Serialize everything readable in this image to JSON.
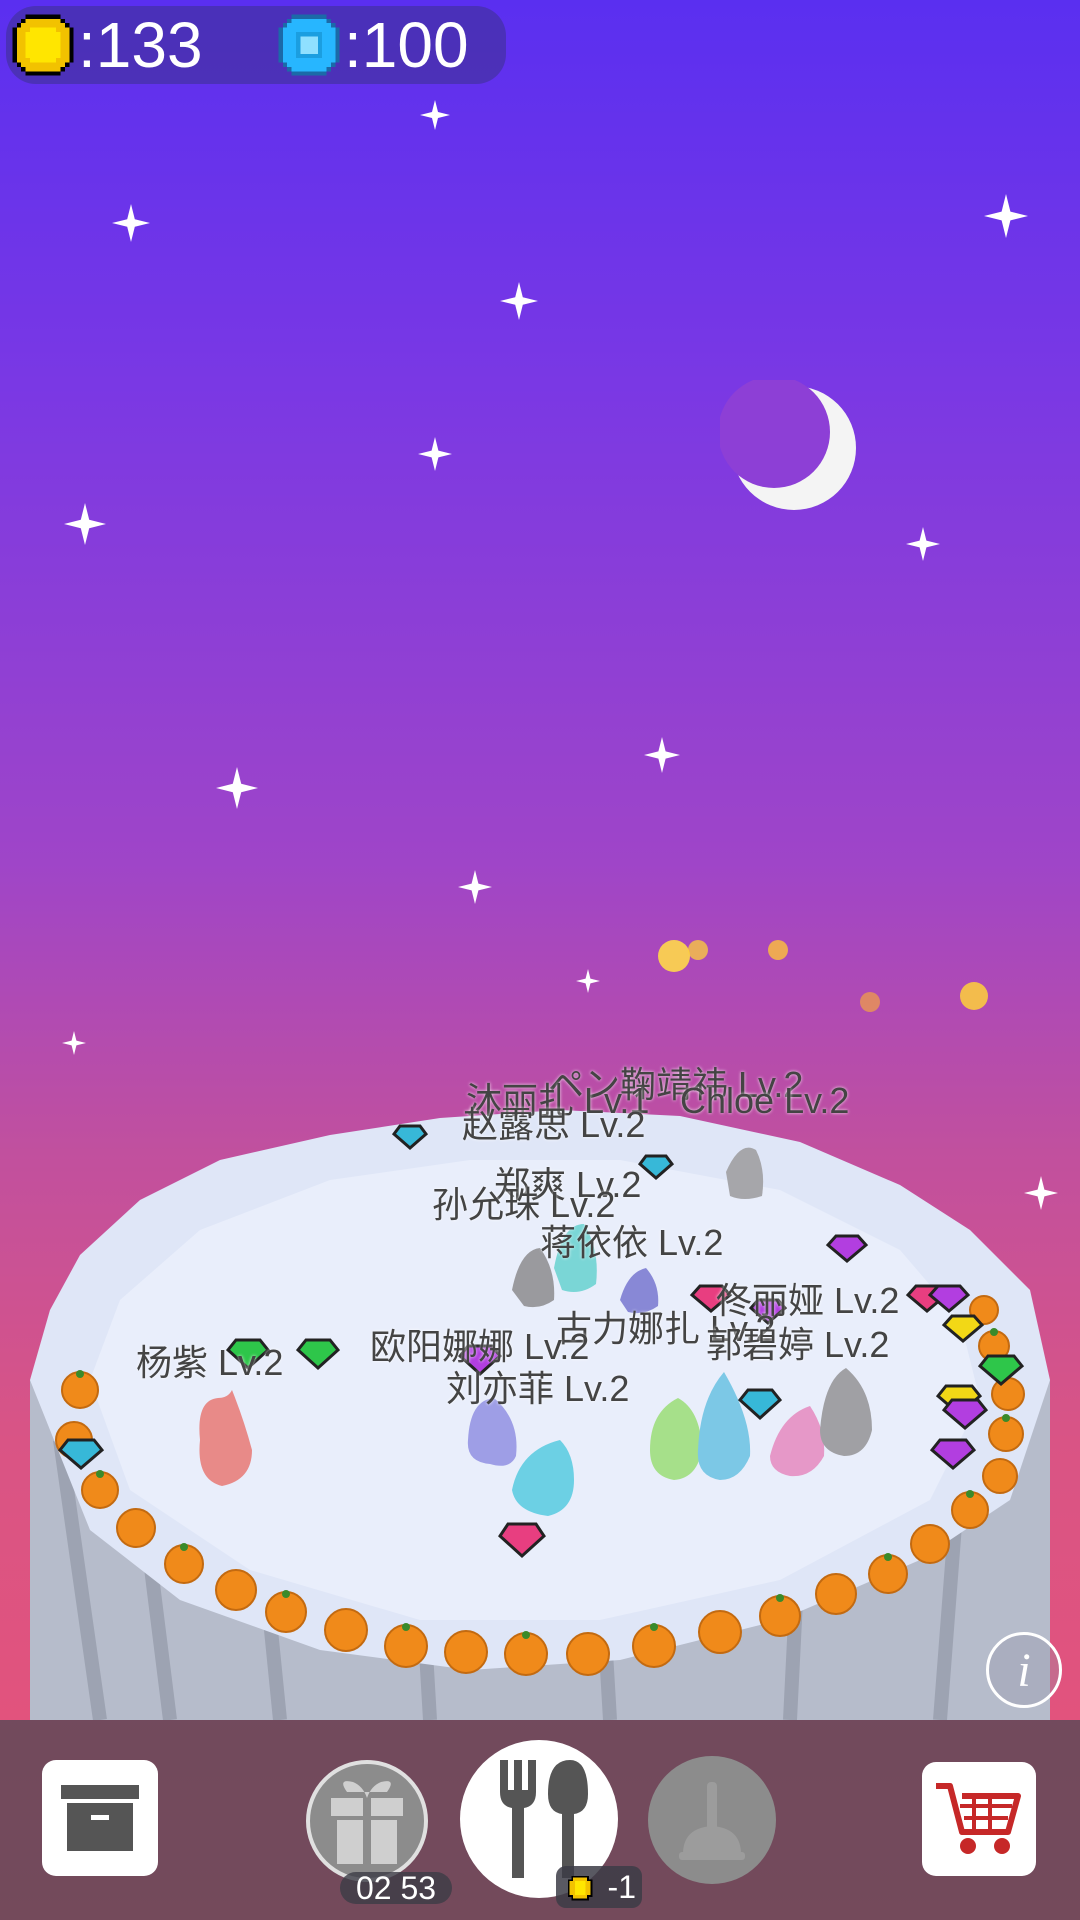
{
  "hud": {
    "coins": ":133",
    "gems": ":100",
    "coin_icon": "coin-icon",
    "gem_icon": "gem-icon"
  },
  "creature_names": [
    "ペン鞠靖祎 Lv.2",
    "沐丽扎 Lv.1",
    "Chloe Lv.2",
    "赵露思 Lv.2",
    "郑爽 Lv.2",
    "孙允珠 Lv.2",
    "蒋依依 Lv.2",
    "佟丽娅 Lv.2",
    "古力娜扎 Lv.2",
    "郭碧婷 Lv.2",
    "杨紫 Lv.2",
    "欧阳娜娜 Lv.2",
    "刘亦菲 Lv.2"
  ],
  "toolbar": {
    "gift_timer": "02 53",
    "feed_cost": "-1",
    "icons": [
      "archive-box-icon",
      "gift-icon",
      "fork-spoon-icon",
      "plunger-icon",
      "cart-icon",
      "info-icon"
    ],
    "info_label": "i"
  },
  "colors": {
    "sky_top": "#5a2ff0",
    "sky_bottom": "#e85277",
    "plate": "#e8eefb",
    "orange": "#f08a1a"
  }
}
